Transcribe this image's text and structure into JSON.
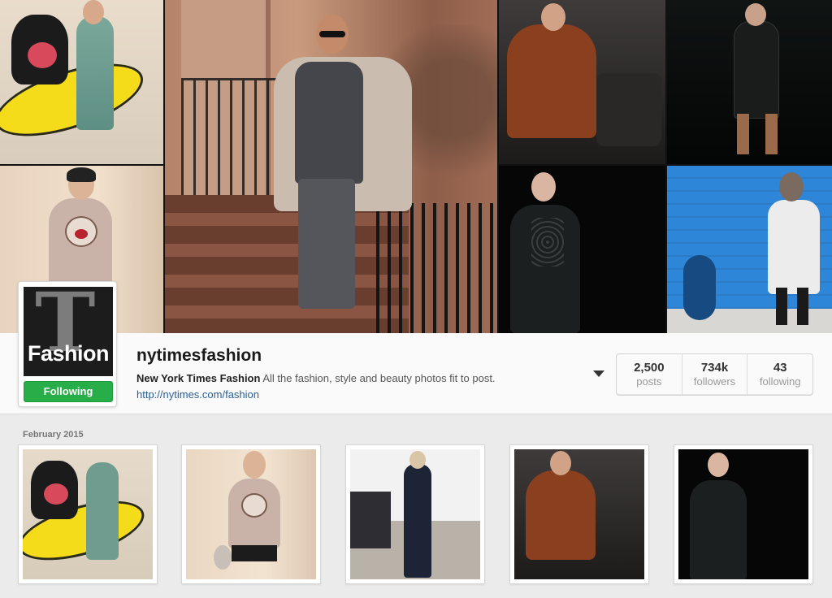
{
  "profile": {
    "avatar_label": "Fashion",
    "follow_button_label": "Following",
    "username": "nytimesfashion",
    "full_name": "New York Times Fashion",
    "bio": "All the fashion, style and beauty photos fit to post.",
    "website": "http://nytimes.com/fashion"
  },
  "stats": [
    {
      "value": "2,500",
      "label": "posts"
    },
    {
      "value": "734k",
      "label": "followers"
    },
    {
      "value": "43",
      "label": "following"
    }
  ],
  "feed": {
    "date_label": "February 2015"
  },
  "colors": {
    "follow_green": "#27ae48",
    "link_blue": "#2a5f96"
  },
  "icons": {
    "options": "caret-down-icon"
  }
}
